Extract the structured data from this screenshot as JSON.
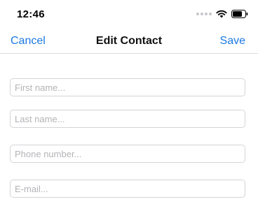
{
  "status": {
    "time": "12:46"
  },
  "nav": {
    "cancel_label": "Cancel",
    "title": "Edit Contact",
    "save_label": "Save"
  },
  "form": {
    "first_name": {
      "value": "",
      "placeholder": "First name..."
    },
    "last_name": {
      "value": "",
      "placeholder": "Last name..."
    },
    "phone": {
      "value": "",
      "placeholder": "Phone number..."
    },
    "email": {
      "value": "",
      "placeholder": "E-mail..."
    }
  },
  "colors": {
    "accent": "#1b7ae0",
    "border": "#d4d4d8",
    "placeholder": "#b4b4b8"
  },
  "icons": [
    "signal-dots-icon",
    "wifi-icon",
    "battery-icon"
  ]
}
